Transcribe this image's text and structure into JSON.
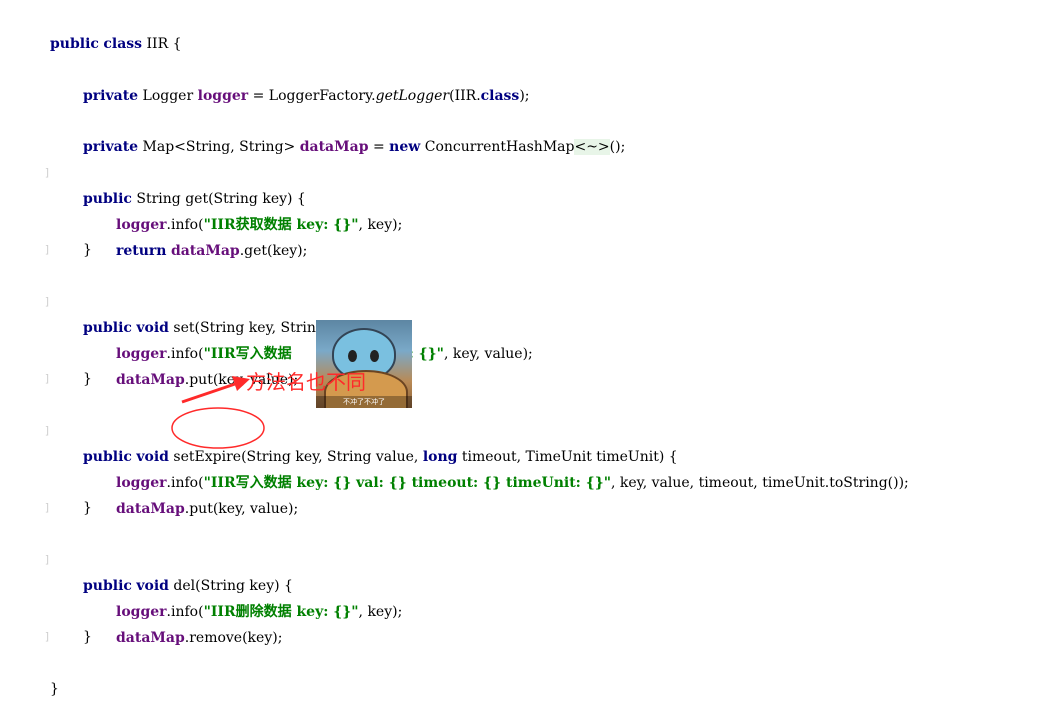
{
  "code": {
    "class_kw": [
      "public",
      "class"
    ],
    "class_name": "IIR",
    "open_brace": "{",
    "close_brace": "}",
    "line_logger": {
      "kw": "private",
      "type": "Logger",
      "field": "logger",
      "eq": "=",
      "call_pre": "LoggerFactory.",
      "method": "getLogger",
      "arg": "(IIR.",
      "class_kw": "class",
      "end": ");"
    },
    "line_map": {
      "kw": "private",
      "type": "Map<String, String>",
      "field": "dataMap",
      "eq": "=",
      "new_kw": "new",
      "ctor": "ConcurrentHashMap",
      "diamond": "<~>",
      "end": "();"
    },
    "method_get": {
      "sig_kw": "public",
      "sig": "String get(String key) {",
      "body1_field": "logger",
      "body1_call": ".info(",
      "body1_str": "\"IIR获取数据 key: {}\"",
      "body1_rest": ", key);",
      "body2_kw": "return",
      "body2_field": "dataMap",
      "body2_rest": ".get(key);",
      "close": "}"
    },
    "method_set": {
      "sig_kw1": "public",
      "sig_kw2": "void",
      "sig": "set(String key, String value) {",
      "body1_field": "logger",
      "body1_call": ".info(",
      "body1_str_a": "\"IIR写入数据",
      "body1_str_b": ": {}\"",
      "body1_rest": ", key, value);",
      "body2_field": "dataMap",
      "body2_rest": ".put(key, value);",
      "close": "}"
    },
    "method_setexpire": {
      "sig_kw1": "public",
      "sig_kw2": "void",
      "name": "setExpire",
      "params_a": "(String key, String value, ",
      "long_kw": "long",
      "params_b": " timeout, TimeUnit timeUnit) {",
      "body1_field": "logger",
      "body1_call": ".info(",
      "body1_str": "\"IIR写入数据 key: {} val: {} timeout: {} timeUnit: {}\"",
      "body1_rest": ", key, value, timeout, timeUnit.toString());",
      "body2_field": "dataMap",
      "body2_rest": ".put(key, value);",
      "close": "}"
    },
    "method_del": {
      "sig_kw1": "public",
      "sig_kw2": "void",
      "sig": "del(String key) {",
      "body1_field": "logger",
      "body1_call": ".info(",
      "body1_str": "\"IIR删除数据 key: {}\"",
      "body1_rest": ", key);",
      "body2_field": "dataMap",
      "body2_rest": ".remove(key);",
      "close": "}"
    }
  },
  "annotation": {
    "text": "方法名也不同",
    "color": "#ff2a2a"
  },
  "overlay_image": {
    "caption": "不冲了不冲了"
  },
  "colors": {
    "keyword": "#000080",
    "field": "#660e7a",
    "string": "#008000",
    "gutter": "#cfcfcf"
  }
}
